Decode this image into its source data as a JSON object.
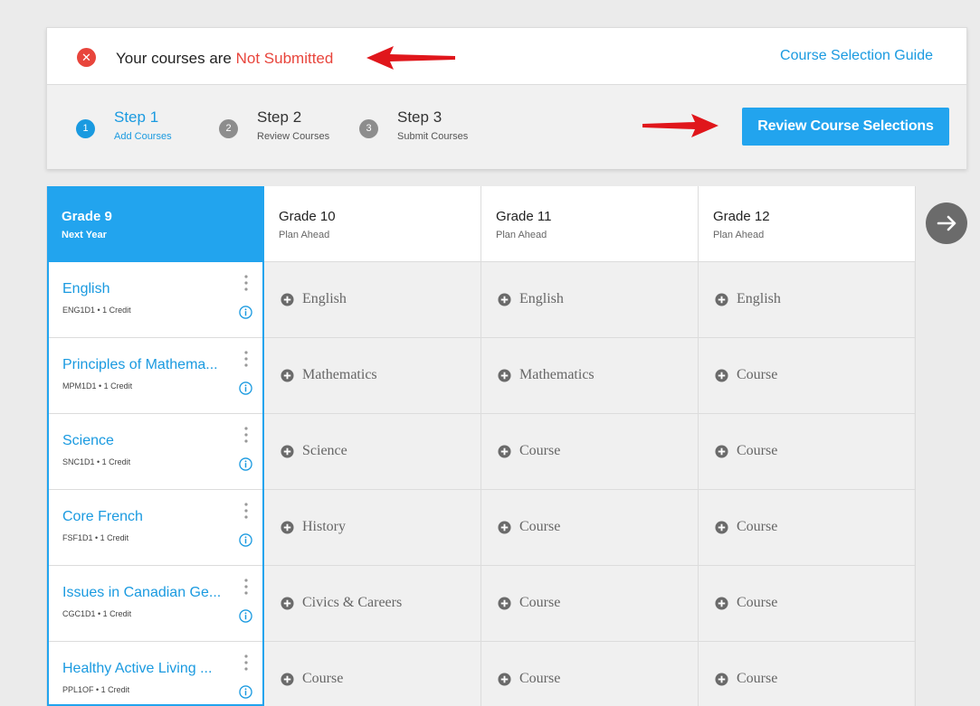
{
  "status": {
    "prefix": "Your courses are ",
    "state": "Not Submitted",
    "guide_link": "Course Selection Guide"
  },
  "steps": [
    {
      "number": "1",
      "title": "Step 1",
      "subtitle": "Add Courses",
      "active": true
    },
    {
      "number": "2",
      "title": "Step 2",
      "subtitle": "Review Courses",
      "active": false
    },
    {
      "number": "3",
      "title": "Step 3",
      "subtitle": "Submit Courses",
      "active": false
    }
  ],
  "review_button": "Review Course Selections",
  "grades": [
    {
      "grade": "Grade 9",
      "period": "Next Year"
    },
    {
      "grade": "Grade 10",
      "period": "Plan Ahead"
    },
    {
      "grade": "Grade 11",
      "period": "Plan Ahead"
    },
    {
      "grade": "Grade 12",
      "period": "Plan Ahead"
    }
  ],
  "grade9_courses": [
    {
      "name": "English",
      "code": "ENG1D1",
      "credit": "1 Credit"
    },
    {
      "name": "Principles of Mathema...",
      "code": "MPM1D1",
      "credit": "1 Credit"
    },
    {
      "name": "Science",
      "code": "SNC1D1",
      "credit": "1 Credit"
    },
    {
      "name": "Core French",
      "code": "FSF1D1",
      "credit": "1 Credit"
    },
    {
      "name": "Issues in Canadian Ge...",
      "code": "CGC1D1",
      "credit": "1 Credit"
    },
    {
      "name": "Healthy Active Living ...",
      "code": "PPL1OF",
      "credit": "1 Credit"
    }
  ],
  "grade10_slots": [
    "English",
    "Mathematics",
    "Science",
    "History",
    "Civics & Careers",
    "Course"
  ],
  "grade11_slots": [
    "English",
    "Mathematics",
    "Course",
    "Course",
    "Course",
    "Course"
  ],
  "grade12_slots": [
    "English",
    "Course",
    "Course",
    "Course",
    "Course",
    "Course"
  ],
  "colors": {
    "accent": "#22a4ee",
    "link": "#1a9ae0",
    "error": "#e8453c",
    "annotation_arrow": "#e0161b"
  },
  "icons": {
    "status": "error-x-icon",
    "info": "info-icon",
    "menu": "kebab-menu-icon",
    "add": "plus-circle-icon",
    "next": "arrow-right-icon"
  }
}
